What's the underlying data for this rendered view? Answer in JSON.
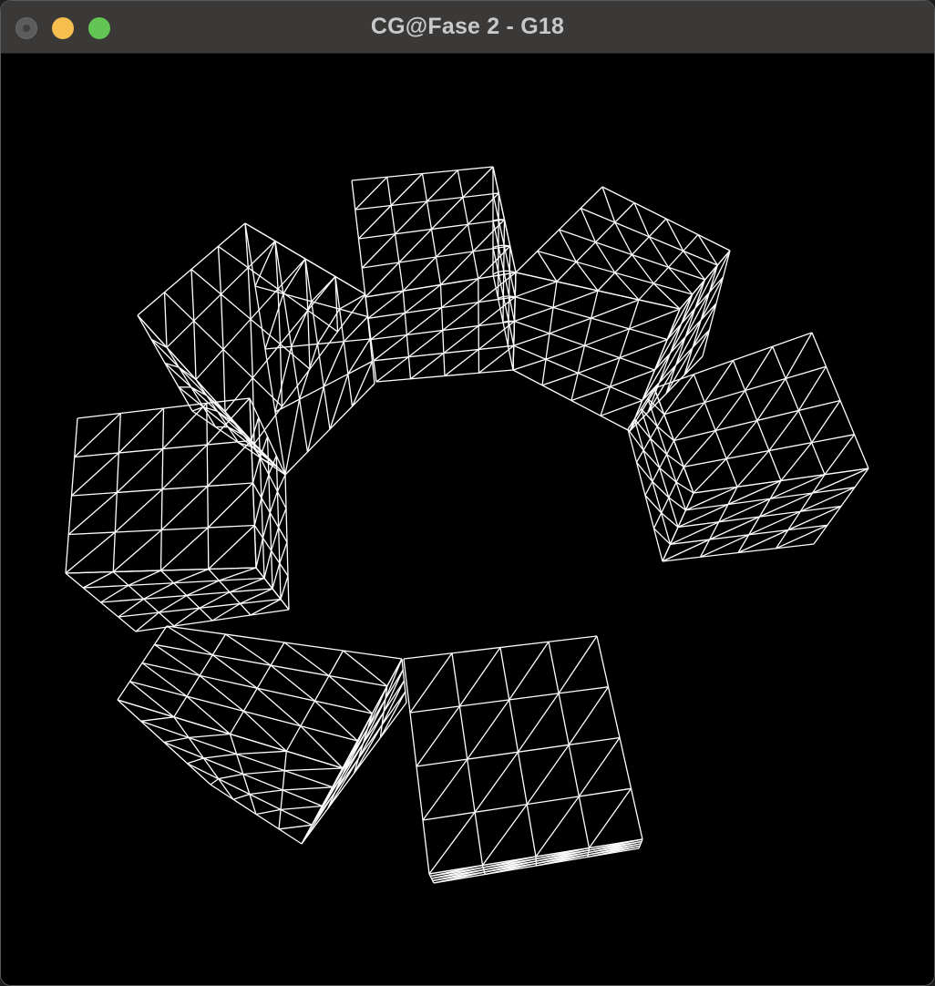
{
  "window": {
    "title": "CG@Fase 2 - G18",
    "buttons": {
      "close": "close-button",
      "minimize": "minimize-button",
      "maximize": "maximize-button"
    }
  },
  "scene": {
    "render_mode": "wireframe",
    "line_color": "#ffffff",
    "background_color": "#000000",
    "object_count": 7,
    "object_type": "subdivided-cube"
  },
  "colors": {
    "titlebar": "#3a3938",
    "title_text": "#c9c9c9",
    "close": "#5c5c5c",
    "minimize": "#f6be4f",
    "maximize": "#62c554"
  }
}
